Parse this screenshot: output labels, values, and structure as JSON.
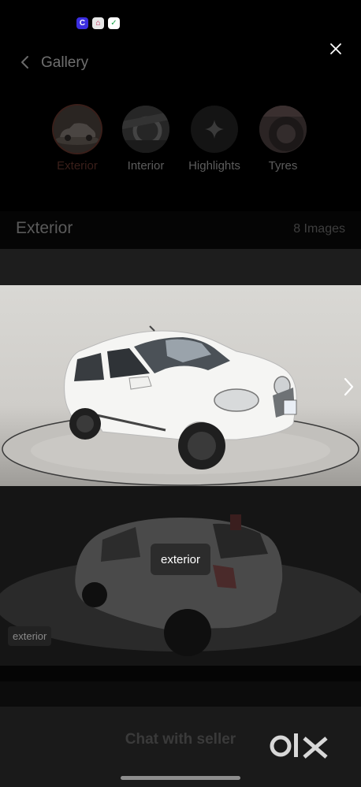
{
  "status_bar": {
    "icons": [
      "app-c-icon",
      "app-lock-icon",
      "app-shield-icon"
    ],
    "icon_glyphs": [
      "C",
      "⌂",
      "✓"
    ]
  },
  "header": {
    "title": "Gallery",
    "back_icon": "chevron-left-icon",
    "close_icon": "close-icon"
  },
  "tabs": [
    {
      "label": "Exterior",
      "active": true
    },
    {
      "label": "Interior",
      "active": false
    },
    {
      "label": "Highlights",
      "active": false
    },
    {
      "label": "Tyres",
      "active": false
    }
  ],
  "section": {
    "title": "Exterior",
    "count": "8 Images"
  },
  "viewer": {
    "tooltip": "exterior",
    "photo_tag": "exterior",
    "next_icon": "chevron-right-icon"
  },
  "footer": {
    "cta": "Chat with seller",
    "brand": "olx-logo"
  },
  "colors": {
    "background": "#000000",
    "car_body": "#f4f4f2",
    "studio_floor": "#b9b7b3"
  }
}
